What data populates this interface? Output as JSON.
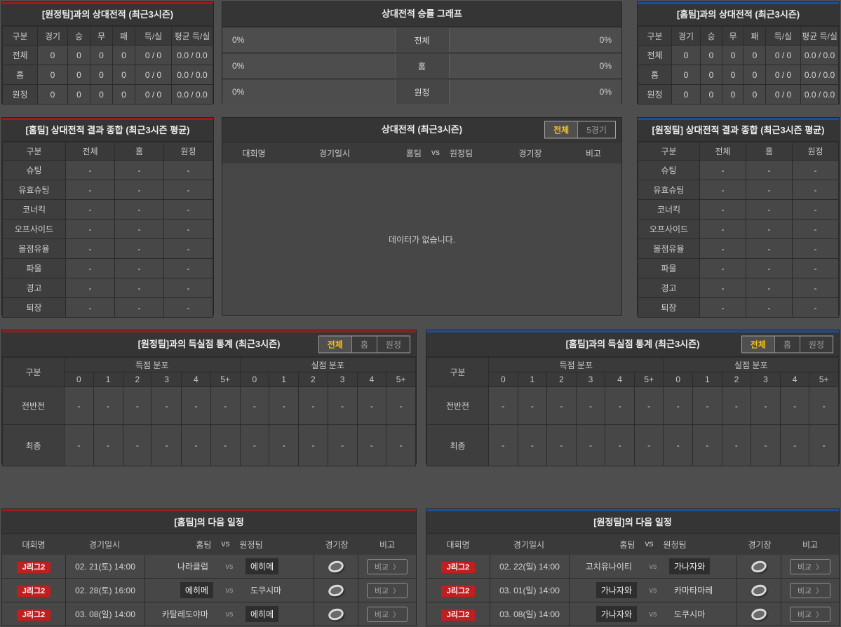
{
  "accents": {
    "red": "#9b1c1c",
    "blue": "#1d4e9b",
    "tab_active_text": "#f2c11c",
    "badge_red": "#c01f1f"
  },
  "icons": {
    "chevron_right": "〉"
  },
  "away_h2h": {
    "title": "[원정팀]과의 상대전적 (최근3시즌)",
    "columns": [
      "구분",
      "경기",
      "승",
      "무",
      "패",
      "득/실",
      "평균 득/실"
    ],
    "rows": [
      {
        "label": "전체",
        "values": [
          "0",
          "0",
          "0",
          "0",
          "0 / 0",
          "0.0 / 0.0"
        ]
      },
      {
        "label": "홈",
        "values": [
          "0",
          "0",
          "0",
          "0",
          "0 / 0",
          "0.0 / 0.0"
        ]
      },
      {
        "label": "원정",
        "values": [
          "0",
          "0",
          "0",
          "0",
          "0 / 0",
          "0.0 / 0.0"
        ]
      }
    ]
  },
  "winrate": {
    "title": "상대전적 승률 그래프",
    "rows": [
      {
        "left": "0%",
        "label": "전체",
        "right": "0%"
      },
      {
        "left": "0%",
        "label": "홈",
        "right": "0%"
      },
      {
        "left": "0%",
        "label": "원정",
        "right": "0%"
      }
    ]
  },
  "home_h2h": {
    "title": "[홈팀]과의 상대전적 (최근3시즌)",
    "columns": [
      "구분",
      "경기",
      "승",
      "무",
      "패",
      "득/실",
      "평균 득/실"
    ],
    "rows": [
      {
        "label": "전체",
        "values": [
          "0",
          "0",
          "0",
          "0",
          "0 / 0",
          "0.0 / 0.0"
        ]
      },
      {
        "label": "홈",
        "values": [
          "0",
          "0",
          "0",
          "0",
          "0 / 0",
          "0.0 / 0.0"
        ]
      },
      {
        "label": "원정",
        "values": [
          "0",
          "0",
          "0",
          "0",
          "0 / 0",
          "0.0 / 0.0"
        ]
      }
    ]
  },
  "home_summary": {
    "title": "[홈팀] 상대전적 결과 종합 (최근3시즌 평균)",
    "columns": [
      "구분",
      "전체",
      "홈",
      "원정"
    ],
    "rows": [
      {
        "label": "슈팅",
        "values": [
          "-",
          "-",
          "-"
        ]
      },
      {
        "label": "유효슈팅",
        "values": [
          "-",
          "-",
          "-"
        ]
      },
      {
        "label": "코너킥",
        "values": [
          "-",
          "-",
          "-"
        ]
      },
      {
        "label": "오프사이드",
        "values": [
          "-",
          "-",
          "-"
        ]
      },
      {
        "label": "볼점유율",
        "values": [
          "-",
          "-",
          "-"
        ]
      },
      {
        "label": "파울",
        "values": [
          "-",
          "-",
          "-"
        ]
      },
      {
        "label": "경고",
        "values": [
          "-",
          "-",
          "-"
        ]
      },
      {
        "label": "퇴장",
        "values": [
          "-",
          "-",
          "-"
        ]
      }
    ]
  },
  "away_summary": {
    "title": "[원정팀] 상대전적 결과 종합 (최근3시즌 평균)",
    "columns": [
      "구분",
      "전체",
      "홈",
      "원정"
    ],
    "rows": [
      {
        "label": "슈팅",
        "values": [
          "-",
          "-",
          "-"
        ]
      },
      {
        "label": "유효슈팅",
        "values": [
          "-",
          "-",
          "-"
        ]
      },
      {
        "label": "코너킥",
        "values": [
          "-",
          "-",
          "-"
        ]
      },
      {
        "label": "오프사이드",
        "values": [
          "-",
          "-",
          "-"
        ]
      },
      {
        "label": "볼점유율",
        "values": [
          "-",
          "-",
          "-"
        ]
      },
      {
        "label": "파울",
        "values": [
          "-",
          "-",
          "-"
        ]
      },
      {
        "label": "경고",
        "values": [
          "-",
          "-",
          "-"
        ]
      },
      {
        "label": "퇴장",
        "values": [
          "-",
          "-",
          "-"
        ]
      }
    ]
  },
  "h2h_list": {
    "title": "상대전적 (최근3시즌)",
    "tabs": [
      {
        "label": "전체",
        "active": true
      },
      {
        "label": "5경기",
        "active": false
      }
    ],
    "columns": {
      "league": "대회명",
      "datetime": "경기일시",
      "home": "홈팀",
      "vs": "vs",
      "away": "원정팀",
      "stadium": "경기장",
      "note": "비고"
    },
    "empty": "데이터가 없습니다."
  },
  "away_goal_stats": {
    "title": "[원정팀]과의 득실점 통계 (최근3시즌)",
    "tabs": [
      {
        "label": "전체",
        "active": true
      },
      {
        "label": "홈",
        "active": false
      },
      {
        "label": "원정",
        "active": false
      }
    ],
    "corner": "구분",
    "groups": [
      "득점 분포",
      "실점 분포"
    ],
    "cols": [
      "0",
      "1",
      "2",
      "3",
      "4",
      "5+"
    ],
    "rows": [
      {
        "label": "전반전",
        "values": [
          "-",
          "-",
          "-",
          "-",
          "-",
          "-",
          "-",
          "-",
          "-",
          "-",
          "-",
          "-"
        ]
      },
      {
        "label": "최종",
        "values": [
          "-",
          "-",
          "-",
          "-",
          "-",
          "-",
          "-",
          "-",
          "-",
          "-",
          "-",
          "-"
        ]
      }
    ]
  },
  "home_goal_stats": {
    "title": "[홈팀]과의 득실점 통계 (최근3시즌)",
    "tabs": [
      {
        "label": "전체",
        "active": true
      },
      {
        "label": "홈",
        "active": false
      },
      {
        "label": "원정",
        "active": false
      }
    ],
    "corner": "구분",
    "groups": [
      "득점 분포",
      "실점 분포"
    ],
    "cols": [
      "0",
      "1",
      "2",
      "3",
      "4",
      "5+"
    ],
    "rows": [
      {
        "label": "전반전",
        "values": [
          "-",
          "-",
          "-",
          "-",
          "-",
          "-",
          "-",
          "-",
          "-",
          "-",
          "-",
          "-"
        ]
      },
      {
        "label": "최종",
        "values": [
          "-",
          "-",
          "-",
          "-",
          "-",
          "-",
          "-",
          "-",
          "-",
          "-",
          "-",
          "-"
        ]
      }
    ]
  },
  "home_schedule": {
    "title": "[홈팀]의 다음 일정",
    "columns": {
      "league": "대회명",
      "datetime": "경기일시",
      "home": "홈팀",
      "vs": "vs",
      "away": "원정팀",
      "stadium": "경기장",
      "note": "비고"
    },
    "compare_label": "비교",
    "rows": [
      {
        "league": "J리그2",
        "datetime": "02. 21(토) 14:00",
        "home": "나라클럽",
        "away": "에히메",
        "highlight": "away"
      },
      {
        "league": "J리그2",
        "datetime": "02. 28(토) 16:00",
        "home": "에히메",
        "away": "도쿠시마",
        "highlight": "home"
      },
      {
        "league": "J리그2",
        "datetime": "03. 08(일) 14:00",
        "home": "카탈레도야마",
        "away": "에히메",
        "highlight": "away"
      }
    ]
  },
  "away_schedule": {
    "title": "[원정팀]의 다음 일정",
    "columns": {
      "league": "대회명",
      "datetime": "경기일시",
      "home": "홈팀",
      "vs": "vs",
      "away": "원정팀",
      "stadium": "경기장",
      "note": "비고"
    },
    "compare_label": "비교",
    "rows": [
      {
        "league": "J리그2",
        "datetime": "02. 22(일) 14:00",
        "home": "고치유나이티",
        "away": "가나자와",
        "highlight": "away"
      },
      {
        "league": "J리그2",
        "datetime": "03. 01(일) 14:00",
        "home": "가나자와",
        "away": "카마타마레",
        "highlight": "home"
      },
      {
        "league": "J리그2",
        "datetime": "03. 08(일) 14:00",
        "home": "가나자와",
        "away": "도쿠시마",
        "highlight": "home"
      }
    ]
  }
}
